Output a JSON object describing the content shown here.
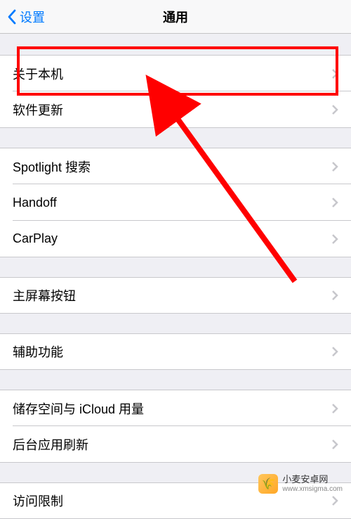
{
  "header": {
    "back_label": "设置",
    "title": "通用"
  },
  "groups": [
    {
      "items": [
        {
          "label": "关于本机"
        },
        {
          "label": "软件更新"
        }
      ]
    },
    {
      "items": [
        {
          "label": "Spotlight 搜索"
        },
        {
          "label": "Handoff"
        },
        {
          "label": "CarPlay"
        }
      ]
    },
    {
      "items": [
        {
          "label": "主屏幕按钮"
        }
      ]
    },
    {
      "items": [
        {
          "label": "辅助功能"
        }
      ]
    },
    {
      "items": [
        {
          "label": "储存空间与 iCloud 用量"
        },
        {
          "label": "后台应用刷新"
        }
      ]
    },
    {
      "items": [
        {
          "label": "访问限制"
        }
      ]
    }
  ],
  "annotation": {
    "highlight_color": "#ff0000"
  },
  "watermark": {
    "title": "小麦安卓网",
    "url": "www.xmsigma.com"
  }
}
